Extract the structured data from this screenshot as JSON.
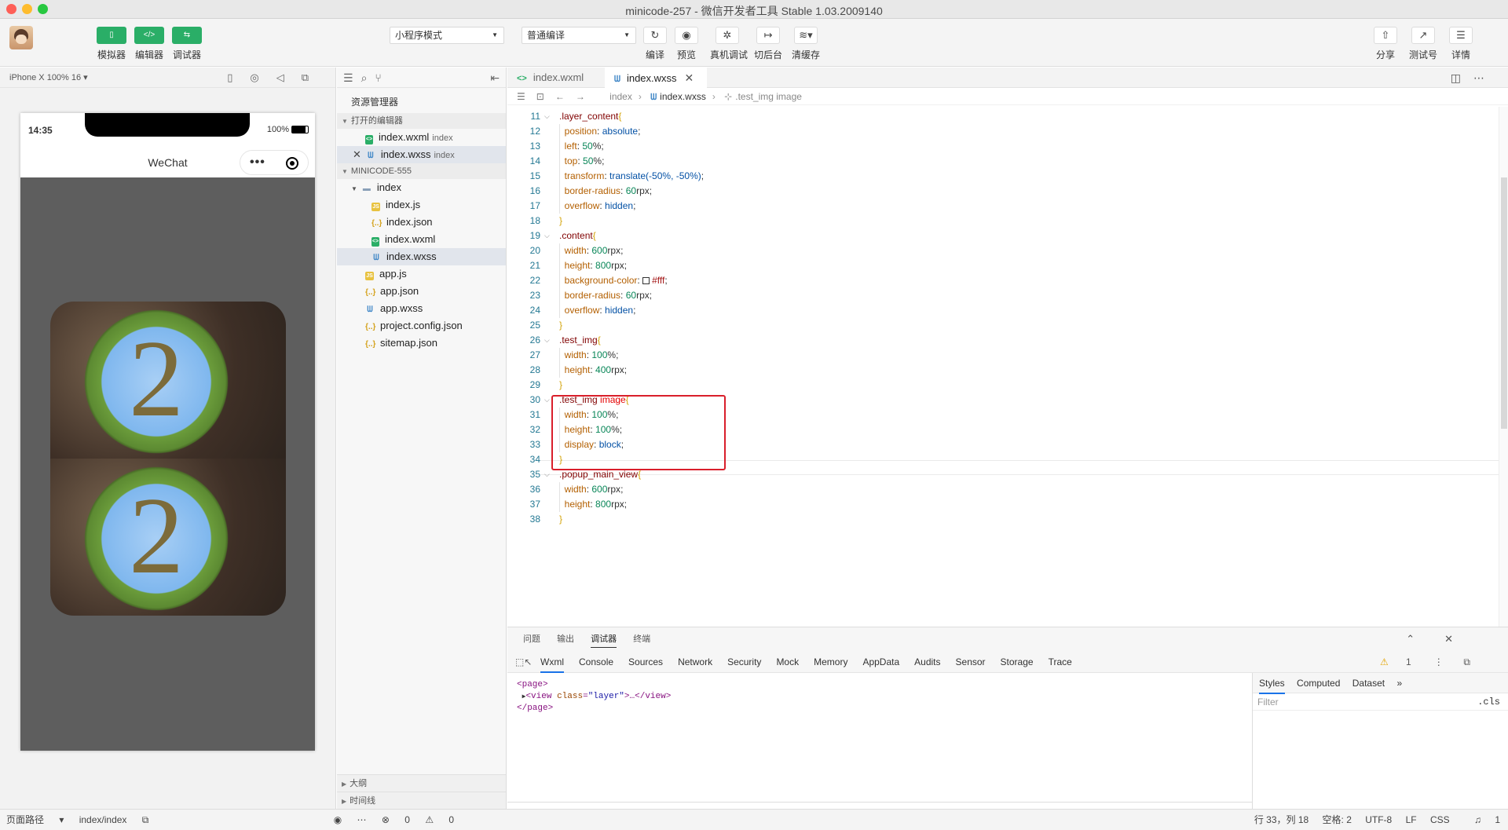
{
  "window": {
    "title": "minicode-257 - 微信开发者工具 Stable 1.03.2009140",
    "traffic_colors": [
      "#fe5f57",
      "#febc2e",
      "#28c840"
    ]
  },
  "toolbar": {
    "simulator": "模拟器",
    "editor": "编辑器",
    "debugger": "调试器",
    "mode_select": "小程序模式",
    "compile_select": "普通编译",
    "compile": "编译",
    "preview": "预览",
    "real_debug": "真机调试",
    "background": "切后台",
    "clear_cache": "清缓存",
    "share": "分享",
    "test_account": "测试号",
    "details": "详情"
  },
  "simulator": {
    "device": "iPhone X 100% 16 ▾",
    "time": "14:35",
    "battery": "100%",
    "nav_title": "WeChat",
    "coin_digit": "2"
  },
  "explorer": {
    "title": "资源管理器",
    "open_editors": "打开的编辑器",
    "open_files": [
      {
        "name": "index.wxml",
        "hint": "index",
        "type": "wx"
      },
      {
        "name": "index.wxss",
        "hint": "index",
        "type": "css"
      }
    ],
    "project": "MINICODE-555",
    "folder": "index",
    "folder_files": [
      {
        "name": "index.js",
        "type": "js"
      },
      {
        "name": "index.json",
        "type": "json"
      },
      {
        "name": "index.wxml",
        "type": "wx"
      },
      {
        "name": "index.wxss",
        "type": "css"
      }
    ],
    "root_files": [
      {
        "name": "app.js",
        "type": "js"
      },
      {
        "name": "app.json",
        "type": "json"
      },
      {
        "name": "app.wxss",
        "type": "css"
      },
      {
        "name": "project.config.json",
        "type": "json"
      },
      {
        "name": "sitemap.json",
        "type": "json"
      }
    ],
    "outline": "大纲",
    "timeline": "时间线"
  },
  "editor": {
    "tabs": [
      {
        "label": "index.wxml",
        "active": false
      },
      {
        "label": "index.wxss",
        "active": true
      }
    ],
    "breadcrumb": [
      "index",
      "index.wxss",
      ".test_img image"
    ],
    "code_lines": [
      {
        "n": "11",
        "sel": ".layer_content",
        "open": true
      },
      {
        "n": "12",
        "prop": "position",
        "val": "absolute"
      },
      {
        "n": "13",
        "prop": "left",
        "num": "50",
        "unit": "%"
      },
      {
        "n": "14",
        "prop": "top",
        "num": "50",
        "unit": "%"
      },
      {
        "n": "15",
        "prop": "transform",
        "val": "translate(-50%, -50%)"
      },
      {
        "n": "16",
        "prop": "border-radius",
        "num": "60",
        "unit": "rpx"
      },
      {
        "n": "17",
        "prop": "overflow",
        "val": "hidden"
      },
      {
        "n": "18",
        "close": true
      },
      {
        "n": "19",
        "sel": ".content",
        "open": true
      },
      {
        "n": "20",
        "prop": "width",
        "num": "600",
        "unit": "rpx"
      },
      {
        "n": "21",
        "prop": "height",
        "num": "800",
        "unit": "rpx"
      },
      {
        "n": "22",
        "prop": "background-color",
        "hash": "#fff"
      },
      {
        "n": "23",
        "prop": "border-radius",
        "num": "60",
        "unit": "rpx"
      },
      {
        "n": "24",
        "prop": "overflow",
        "val": "hidden"
      },
      {
        "n": "25",
        "close": true
      },
      {
        "n": "26",
        "sel": ".test_img",
        "open": true
      },
      {
        "n": "27",
        "prop": "width",
        "num": "100",
        "unit": "%"
      },
      {
        "n": "28",
        "prop": "height",
        "num": "400",
        "unit": "rpx"
      },
      {
        "n": "29",
        "close": true
      },
      {
        "n": "30",
        "sel": ".test_img",
        "sel2": "image",
        "open": true
      },
      {
        "n": "31",
        "prop": "width",
        "num": "100",
        "unit": "%"
      },
      {
        "n": "32",
        "prop": "height",
        "num": "100",
        "unit": "%"
      },
      {
        "n": "33",
        "prop": "display",
        "val": "block"
      },
      {
        "n": "34",
        "close": true
      },
      {
        "n": "35",
        "sel": ".popup_main_view",
        "open": true
      },
      {
        "n": "36",
        "prop": "width",
        "num": "600",
        "unit": "rpx"
      },
      {
        "n": "37",
        "prop": "height",
        "num": "800",
        "unit": "rpx"
      },
      {
        "n": "38",
        "close": true
      }
    ]
  },
  "panel": {
    "top_tabs": [
      "问题",
      "输出",
      "调试器",
      "终端"
    ],
    "active_top": "调试器",
    "devtools_tabs": [
      "Wxml",
      "Console",
      "Sources",
      "Network",
      "Security",
      "Mock",
      "Memory",
      "AppData",
      "Audits",
      "Sensor",
      "Storage",
      "Trace"
    ],
    "active_devtools": "Wxml",
    "warning_count": "1",
    "dom": {
      "page_open": "<page>",
      "view_tag": "view",
      "attr": "class",
      "attr_val": "\"layer\"",
      "ellipsis": ">…</",
      "page_close": "</page>"
    },
    "style_tabs": [
      "Styles",
      "Computed",
      "Dataset"
    ],
    "filter_placeholder": "Filter",
    "cls": ".cls"
  },
  "status": {
    "page_path": "页面路径",
    "path_value": "index/index",
    "errors": "0",
    "warnings": "0",
    "cursor": "行 33，列 18",
    "spaces": "空格: 2",
    "encoding": "UTF-8",
    "eol": "LF",
    "language": "CSS",
    "bell": "1"
  }
}
